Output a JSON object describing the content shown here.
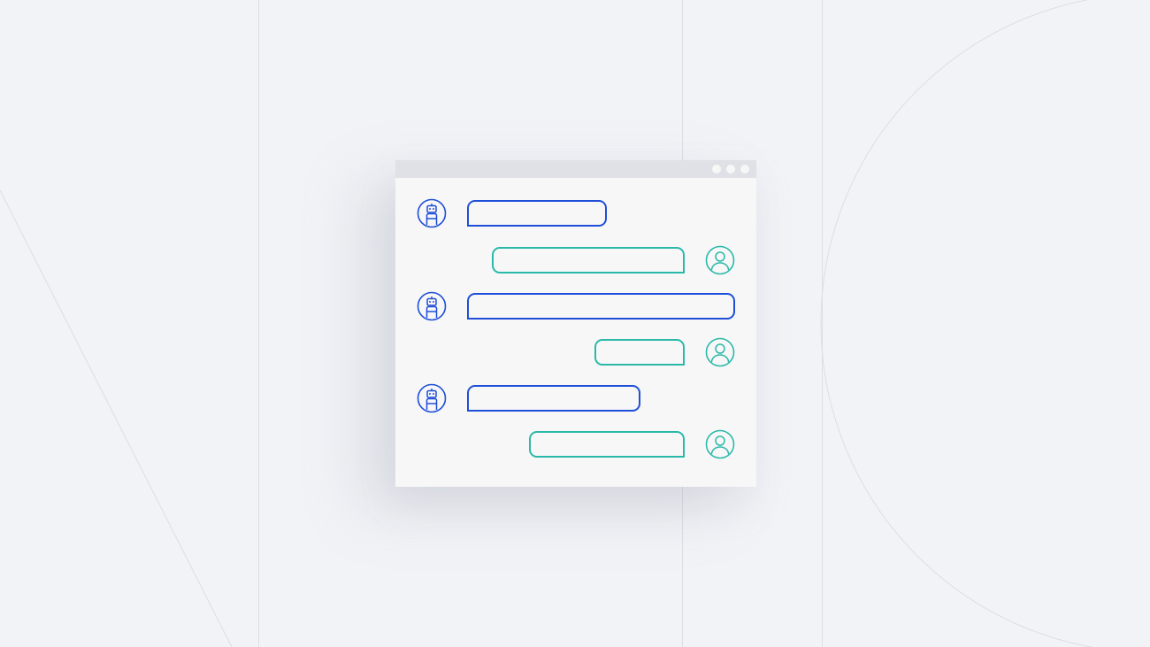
{
  "colors": {
    "background": "#f2f3f7",
    "window_bg": "#f7f7f8",
    "titlebar": "#dfe1e6",
    "bot_accent": "#1f4fd8",
    "user_accent": "#2ab9a9",
    "guide_lines": "#dcdee4"
  },
  "window": {
    "titlebar_controls": [
      "window-control-dot",
      "window-control-dot",
      "window-control-dot"
    ]
  },
  "messages": [
    {
      "sender": "bot",
      "icon": "robot-icon"
    },
    {
      "sender": "user",
      "icon": "user-icon"
    },
    {
      "sender": "bot",
      "icon": "robot-icon"
    },
    {
      "sender": "user",
      "icon": "user-icon"
    },
    {
      "sender": "bot",
      "icon": "robot-icon"
    },
    {
      "sender": "user",
      "icon": "user-icon"
    }
  ]
}
